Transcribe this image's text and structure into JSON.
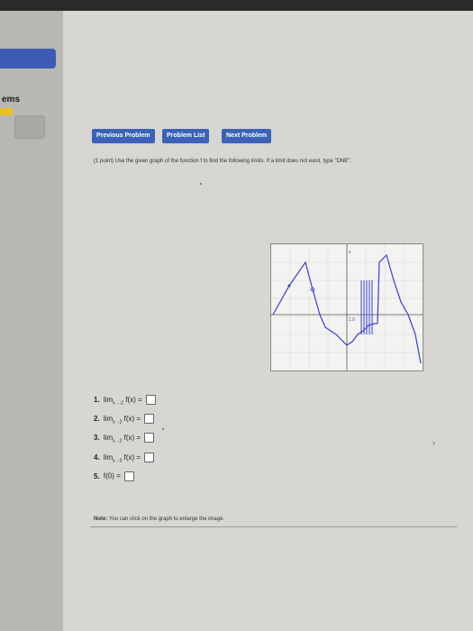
{
  "nav": {
    "previous": "Previous Problem",
    "list": "Problem List",
    "next": "Next Problem"
  },
  "sidebar": {
    "label": "ems"
  },
  "problem": {
    "instructions": "(1 point) Use the given graph of the function f to find the following limits. If a limit does not exist, type \"DNE\".",
    "items": [
      {
        "num": "1.",
        "text": "lim f(x) =",
        "sub": "x→-2"
      },
      {
        "num": "2.",
        "text": "lim f(x) =",
        "sub": "x→2"
      },
      {
        "num": "3.",
        "text": "lim f(x) =",
        "sub": "x→2"
      },
      {
        "num": "4.",
        "text": "lim f(x) =",
        "sub": "x→0"
      },
      {
        "num": "5.",
        "text": "f(0) ="
      }
    ],
    "note_label": "Note:",
    "note_text": "You can click on the graph to enlarge the image."
  },
  "graph": {
    "x_label": "x",
    "y_label": "1.0",
    "curve_color": "#3a3fd0"
  }
}
